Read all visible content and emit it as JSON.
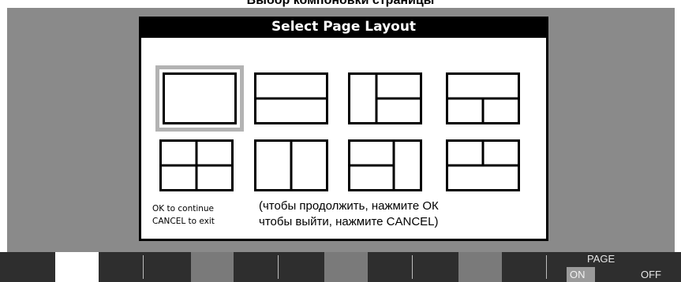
{
  "caption": "Выбор компоновки страницы",
  "dialog": {
    "title": "Select Page Layout",
    "selected_index": 0,
    "hint_lines": [
      "OK to continue",
      "CANCEL to exit"
    ],
    "translation_lines": [
      "(чтобы продолжить, нажмите ОК",
      "чтобы выйти, нажмите CANCEL)"
    ]
  },
  "softkeys": {
    "page_label": "PAGE",
    "on_label": "ON",
    "off_label": "OFF",
    "page_state": "ON"
  },
  "colors": {
    "screen_bg": "#8a8a8a",
    "softkey_bar": "#2e2e2e",
    "selection": "#b3b3b3",
    "title_bar": "#000000"
  }
}
